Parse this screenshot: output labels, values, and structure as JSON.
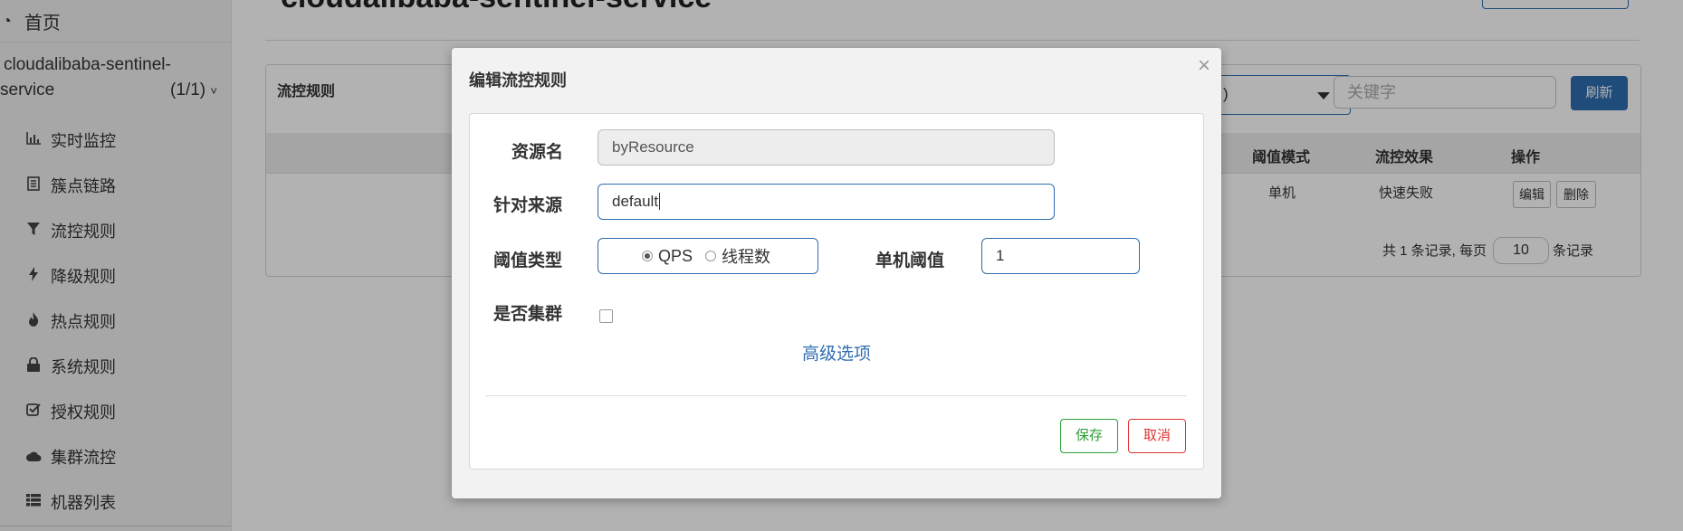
{
  "sidebar": {
    "home_label": "首页",
    "app_name": "cloudalibaba-sentinel-",
    "app_name_2": "service",
    "app_count": "(1/1)",
    "items": [
      {
        "label": "实时监控",
        "icon": "bar-chart-icon"
      },
      {
        "label": "簇点链路",
        "icon": "list-icon"
      },
      {
        "label": "流控规则",
        "icon": "filter-icon"
      },
      {
        "label": "降级规则",
        "icon": "bolt-icon"
      },
      {
        "label": "热点规则",
        "icon": "fire-icon"
      },
      {
        "label": "系统规则",
        "icon": "lock-icon"
      },
      {
        "label": "授权规则",
        "icon": "check-square-icon"
      },
      {
        "label": "集群流控",
        "icon": "cloud-icon"
      },
      {
        "label": "机器列表",
        "icon": "th-list-icon"
      }
    ]
  },
  "page": {
    "title": "cloudalibaba-sentinel-service"
  },
  "panel": {
    "title": "流控规则",
    "select_value": ")",
    "keyword_placeholder": "关键字",
    "refresh_label": "刷新",
    "headers": [
      "阈值模式",
      "流控效果",
      "操作"
    ],
    "row": {
      "mode": "单机",
      "effect": "快速失败",
      "edit": "编辑",
      "delete": "删除"
    },
    "pager_prefix": "共 1 条记录, 每页",
    "page_size": "10",
    "pager_suffix": "条记录"
  },
  "modal": {
    "title": "编辑流控规则",
    "close": "×",
    "resource_label": "资源名",
    "resource_value": "byResource",
    "origin_label": "针对来源",
    "origin_value": "default",
    "threshold_type_label": "阈值类型",
    "qps_label": "QPS",
    "thread_label": "线程数",
    "threshold_label": "单机阈值",
    "threshold_value": "1",
    "cluster_label": "是否集群",
    "advanced_label": "高级选项",
    "save_label": "保存",
    "cancel_label": "取消"
  },
  "colors": {
    "primary": "#2f6db0",
    "success": "#2aa033",
    "danger": "#dd3333"
  }
}
